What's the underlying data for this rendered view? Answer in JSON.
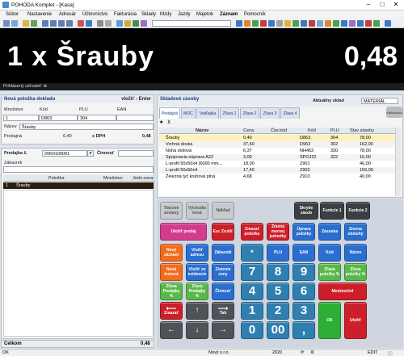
{
  "window": {
    "title": "POHODA Komplet - [Kasa]",
    "min": "–",
    "max": "□",
    "close": "✕"
  },
  "menu": [
    "Súbor",
    "Nastavenie",
    "Adresár",
    "Účtovníctvo",
    "Fakturácia",
    "Sklady",
    "Mzdy",
    "Jazdy",
    "Majetok",
    "Záznam",
    "Pomocník"
  ],
  "banner": {
    "left": "1 x  Šrauby",
    "right": "0,48"
  },
  "user_bar": "Prihlásený užívateľ: ",
  "new_item": {
    "header": "Nová položka dokladu",
    "hint": "vložiť - Enter",
    "col_mnozstvo": "Množstvo",
    "col_kod": "Kód",
    "col_plu": "PLU",
    "col_ean": "EAN",
    "val_mnozstvo": "1",
    "val_kod": "D863",
    "val_plu": "304",
    "val_ean": "",
    "nazov_label": "Názov",
    "nazov_value": "Šrauby",
    "predajna_label": "Predajná",
    "predajna_value": "0,40",
    "sdph_label": "s DPH",
    "sdph_value": "0,48"
  },
  "sale": {
    "predajka_label": "Predajka č.",
    "predajka_value": "20K0100001",
    "cinnost_label": "Činnosť",
    "cinnost_value": "",
    "zakaznik_label": "Zákazník",
    "zakaznik_value": "",
    "col_polozka": "Položka",
    "col_mnozstvo": "Množstvo",
    "col_jedn": "Jedn.cena",
    "rows": [
      {
        "n": "1",
        "name": "Šrauby",
        "qty": "",
        "price": ""
      }
    ],
    "celkom_label": "Celkom",
    "celkom_value": "0,48"
  },
  "stock": {
    "header": "Skladové zásoby",
    "sklad_label": "Aktuálny sklad",
    "sklad_value": "MATERIÁL",
    "kalk_button": "Kalkulačka",
    "tabs": [
      "Predajná",
      "MOC",
      "Vedľajšia",
      "Zľava 1",
      "Zľava 2",
      "Zľava 3",
      "Zľava 4"
    ],
    "col_nazov": "Názov",
    "col_cena": "Cena",
    "col_ciar": "Čiar.kód",
    "col_kod": "Kód",
    "col_plu": "PLU",
    "col_stav": "Stav zásoby",
    "rows": [
      {
        "name": "Šrauby",
        "cena": "0,40",
        "ciar": "",
        "kod": "D863",
        "plu": "304",
        "stav": "78,00"
      },
      {
        "name": "Vrchná doska",
        "cena": "37,60",
        "ciar": "",
        "kod": "D963",
        "plu": "302",
        "stav": "162,00"
      },
      {
        "name": "Noha stolová",
        "cena": "6,37",
        "ciar": "",
        "kod": "NH453",
        "plu": "330",
        "stav": "78,00"
      },
      {
        "name": "Spojovacia súprava A22",
        "cena": "3,00",
        "ciar": "",
        "kod": "SPOJ22",
        "plu": "322",
        "stav": "16,00"
      },
      {
        "name": "L-profil 50x50x4 (6000 mm...",
        "cena": "18,00",
        "ciar": "",
        "kod": "Z901",
        "plu": "",
        "stav": "46,00"
      },
      {
        "name": "L-profil 50x50x4",
        "cena": "17,40",
        "ciar": "",
        "kod": "Z902",
        "plu": "",
        "stav": "156,00"
      },
      {
        "name": "Železná tyč kruhová plná",
        "cena": "4,68",
        "ciar": "",
        "kod": "Z910",
        "plu": "",
        "stav": "40,00"
      }
    ]
  },
  "keypad": {
    "tlacove": "Tlačové zostavy",
    "vychodisko": "Východis ková",
    "nahlad": "Náhľad",
    "skrytie": "Skrytie zásob",
    "f1": "Funkcie 1",
    "f2": "Funkcie 2",
    "ulozit_predaj": "Uložiť predaj",
    "esc": "Esc Zrušiť",
    "zmazat_polozku": "Zmazať položku",
    "zmena_jednotky": "Zmena mernej jednotky",
    "uprava_polozky": "Úprava položky",
    "zasuvka": "Zásuvka",
    "zmena_obsluhy": "Zmena obsluhy",
    "novy_zaznam": "Nový záznam",
    "vlozit_adresu": "Vložiť adresu",
    "zakaznik": "Zákazník",
    "star": "*",
    "plu": "PLU",
    "ean": "EAN",
    "kod": "Kód",
    "nazov": "Názov",
    "nova_textova": "Nová textová",
    "vlozit_z_evid": "Vložiť zo evidencie",
    "zistenie_ceny": "Zistenie ceny",
    "zlava_predajky": "Zľava Predajky %",
    "zlava_predajky2": "Zľava Predajky %",
    "cinnost": "Činnosť",
    "zlava_polozky": "Zľava položky %",
    "zlava_polozky2": "Zľava položky %",
    "medzisucet": "Medzisúčet",
    "zmazat": "Zmazať",
    "tab": "Tab",
    "ok": "OK",
    "ulozit": "Uložiť",
    "d7": "7",
    "d8": "8",
    "d9": "9",
    "d4": "4",
    "d5": "5",
    "d6": "6",
    "d1": "1",
    "d2": "2",
    "d3": "3",
    "d0": "0",
    "d00": "00",
    "dcomma": ","
  },
  "status": {
    "left": "OK",
    "company": "Nový s.r.o.",
    "year": "2020",
    "mode": "EDIT",
    "hour": ""
  }
}
